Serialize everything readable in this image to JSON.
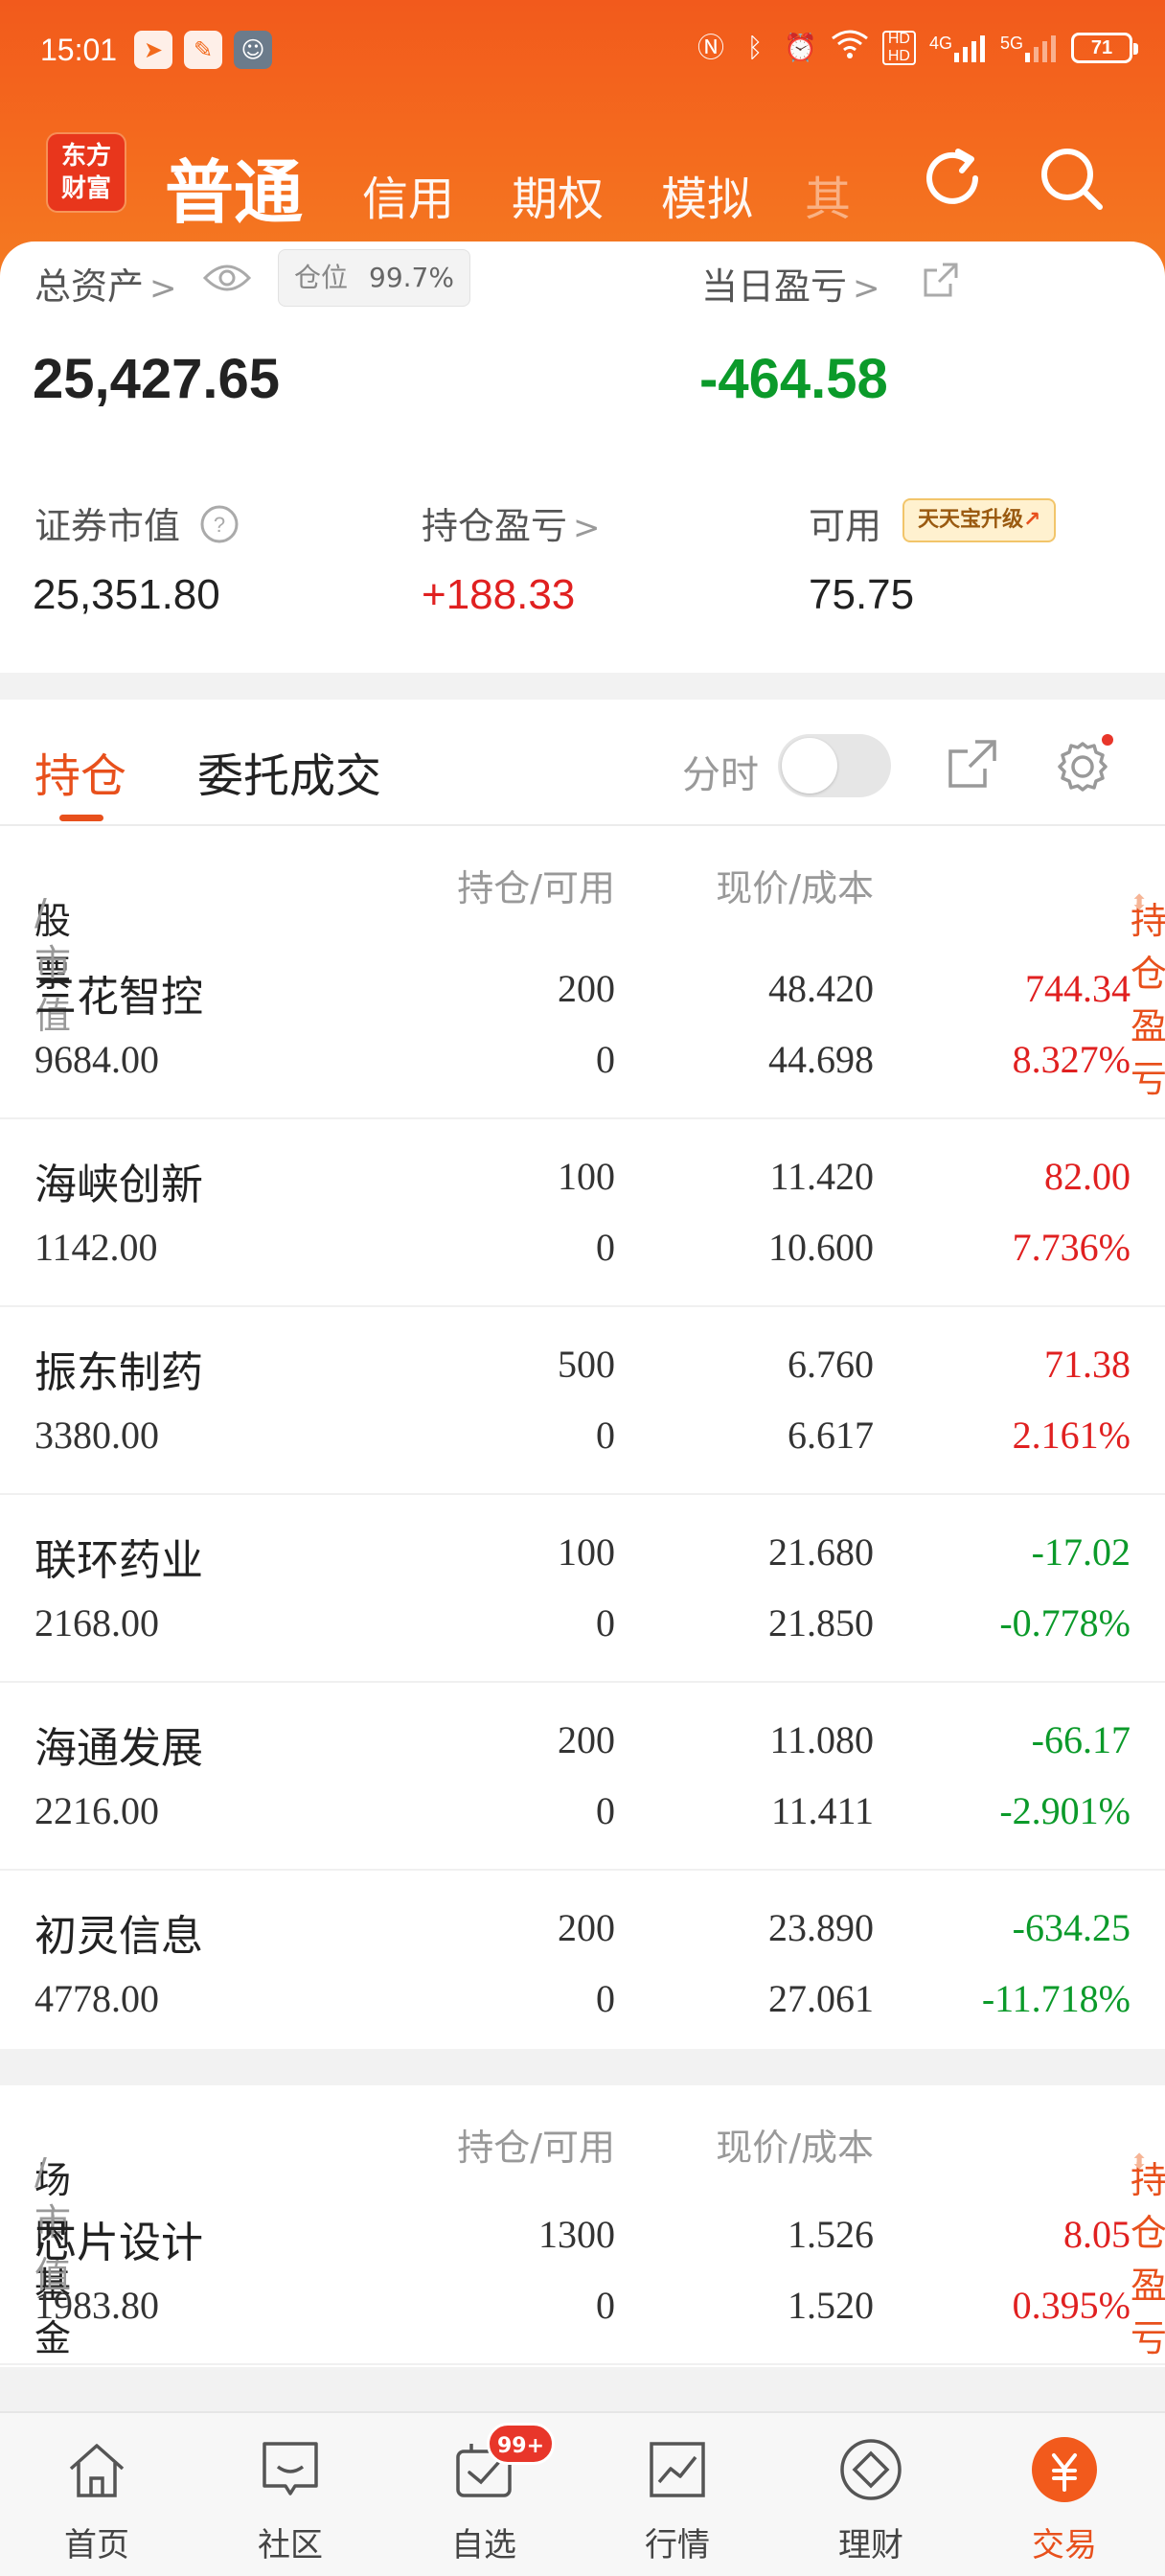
{
  "status_bar": {
    "time": "15:01",
    "app_icons": [
      "send-icon",
      "notes-icon",
      "avatar-thumbnail"
    ],
    "indicators": [
      "nfc-icon",
      "bluetooth-icon",
      "alarm-icon",
      "wifi-icon"
    ],
    "hd_top": "HD",
    "hd_bottom": "HD",
    "net1": "4G",
    "net2": "5G",
    "battery": "71"
  },
  "header": {
    "logo_line1": "东方",
    "logo_line2": "财富",
    "account_tabs": [
      "普通",
      "信用",
      "期权",
      "模拟"
    ],
    "active_tab": "普通",
    "faded_tab_glyph": "其",
    "refresh_icon": "refresh-icon",
    "search_icon": "search-icon"
  },
  "summary": {
    "total_assets_label": "总资产",
    "position_label": "仓位",
    "position_value": "99.7%",
    "total_assets": "25,427.65",
    "daily_pnl_label": "当日盈亏",
    "daily_pnl": "-464.58",
    "market_value_label": "证券市值",
    "market_value": "25,351.80",
    "holding_pnl_label": "持仓盈亏",
    "holding_pnl": "+188.33",
    "available_label": "可用",
    "available": "75.75",
    "upgrade_badge": "天天宝升级"
  },
  "holdings": {
    "tabs": [
      "持仓",
      "委托成交"
    ],
    "fenshi_label": "分时",
    "stocks_header": {
      "col1_main": "股票",
      "col1_sub": "/市值",
      "col2": "持仓/可用",
      "col3": "现价/成本",
      "col4": "持仓盈亏"
    },
    "stocks": [
      {
        "name": "三花智控",
        "market_value": "9684.00",
        "qty": "200",
        "avail": "0",
        "price": "48.420",
        "cost": "44.698",
        "pnl": "744.34",
        "pnl_pct": "8.327%",
        "trend": "up"
      },
      {
        "name": "海峡创新",
        "market_value": "1142.00",
        "qty": "100",
        "avail": "0",
        "price": "11.420",
        "cost": "10.600",
        "pnl": "82.00",
        "pnl_pct": "7.736%",
        "trend": "up"
      },
      {
        "name": "振东制药",
        "market_value": "3380.00",
        "qty": "500",
        "avail": "0",
        "price": "6.760",
        "cost": "6.617",
        "pnl": "71.38",
        "pnl_pct": "2.161%",
        "trend": "up"
      },
      {
        "name": "联环药业",
        "market_value": "2168.00",
        "qty": "100",
        "avail": "0",
        "price": "21.680",
        "cost": "21.850",
        "pnl": "-17.02",
        "pnl_pct": "-0.778%",
        "trend": "down"
      },
      {
        "name": "海通发展",
        "market_value": "2216.00",
        "qty": "200",
        "avail": "0",
        "price": "11.080",
        "cost": "11.411",
        "pnl": "-66.17",
        "pnl_pct": "-2.901%",
        "trend": "down"
      },
      {
        "name": "初灵信息",
        "market_value": "4778.00",
        "qty": "200",
        "avail": "0",
        "price": "23.890",
        "cost": "27.061",
        "pnl": "-634.25",
        "pnl_pct": "-11.718%",
        "trend": "down"
      }
    ],
    "funds_header": {
      "col1_main": "场内基金",
      "col1_sub": "/市值",
      "col2": "持仓/可用",
      "col3": "现价/成本",
      "col4": "持仓盈亏"
    },
    "funds": [
      {
        "name": "芯片设计",
        "market_value": "1983.80",
        "qty": "1300",
        "avail": "0",
        "price": "1.526",
        "cost": "1.520",
        "pnl": "8.05",
        "pnl_pct": "0.395%",
        "trend": "up"
      }
    ]
  },
  "bottom_nav": {
    "items": [
      {
        "label": "首页",
        "icon": "home-icon"
      },
      {
        "label": "社区",
        "icon": "community-icon"
      },
      {
        "label": "自选",
        "icon": "watchlist-icon"
      },
      {
        "label": "行情",
        "icon": "market-chart-icon"
      },
      {
        "label": "理财",
        "icon": "wealth-icon"
      },
      {
        "label": "交易",
        "icon": "trade-yen-icon"
      }
    ],
    "active": "交易",
    "watchlist_badge": "99+"
  },
  "colors": {
    "brand_orange": "#f25a1c",
    "accent": "#e8501c",
    "up_red": "#e02020",
    "down_green": "#0b9a2a"
  }
}
